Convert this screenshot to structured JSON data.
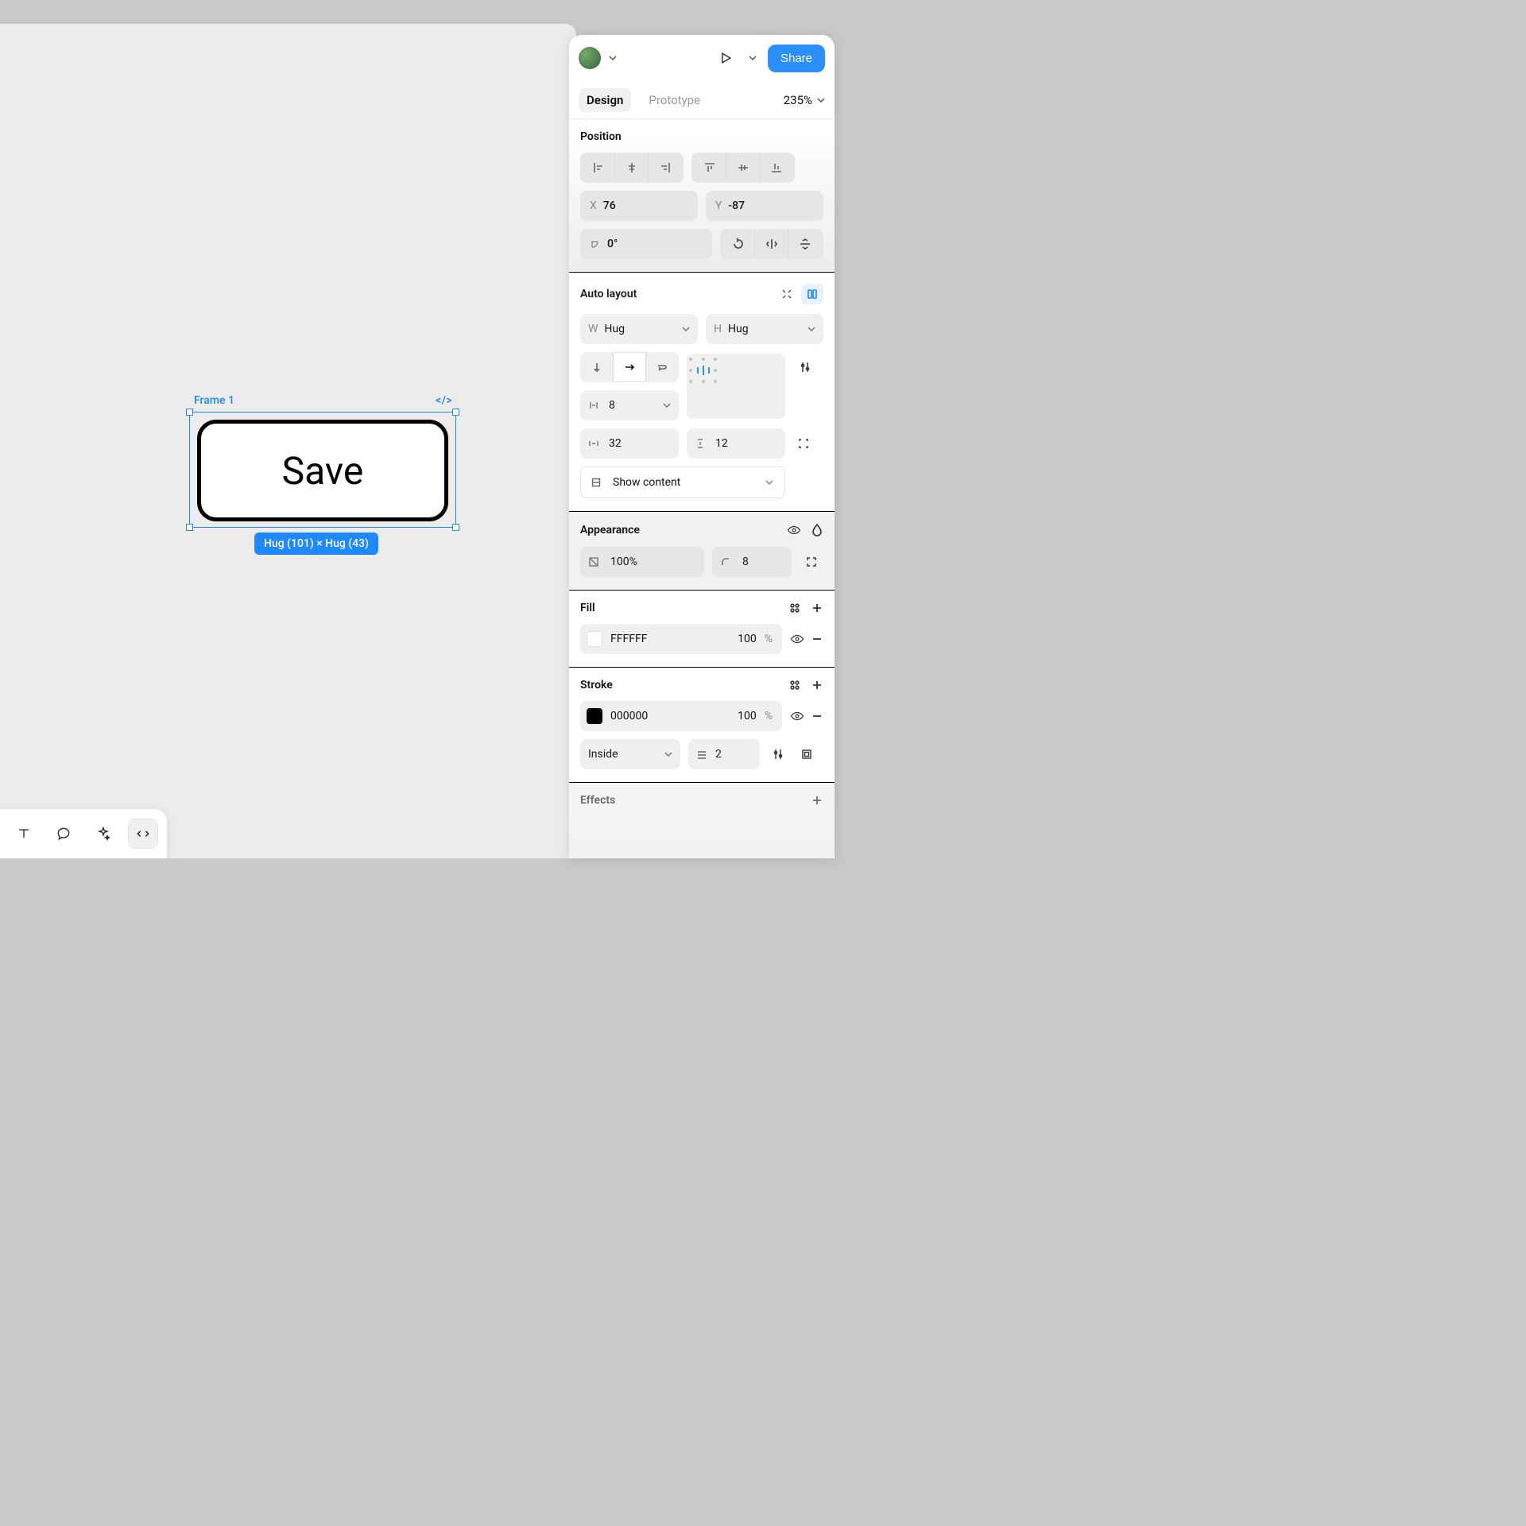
{
  "canvas": {
    "frame_label": "Frame 1",
    "dev_badge": "</>",
    "button_text": "Save",
    "size_pill": "Hug (101) × Hug (43)"
  },
  "topbar": {
    "share": "Share"
  },
  "tabs": {
    "design": "Design",
    "prototype": "Prototype",
    "zoom": "235%"
  },
  "position": {
    "title": "Position",
    "x_label": "X",
    "x_value": "76",
    "y_label": "Y",
    "y_value": "-87",
    "angle_value": "0°"
  },
  "autolayout": {
    "title": "Auto layout",
    "w_label": "W",
    "w_value": "Hug",
    "h_label": "H",
    "h_value": "Hug",
    "gap_value": "8",
    "pad_h_value": "32",
    "pad_v_value": "12",
    "clip": "Show content"
  },
  "appearance": {
    "title": "Appearance",
    "opacity": "100%",
    "radius": "8"
  },
  "fill": {
    "title": "Fill",
    "hex": "FFFFFF",
    "opacity": "100",
    "pct": "%"
  },
  "stroke": {
    "title": "Stroke",
    "hex": "000000",
    "opacity": "100",
    "pct": "%",
    "position": "Inside",
    "width": "2"
  },
  "effects": {
    "title": "Effects"
  }
}
